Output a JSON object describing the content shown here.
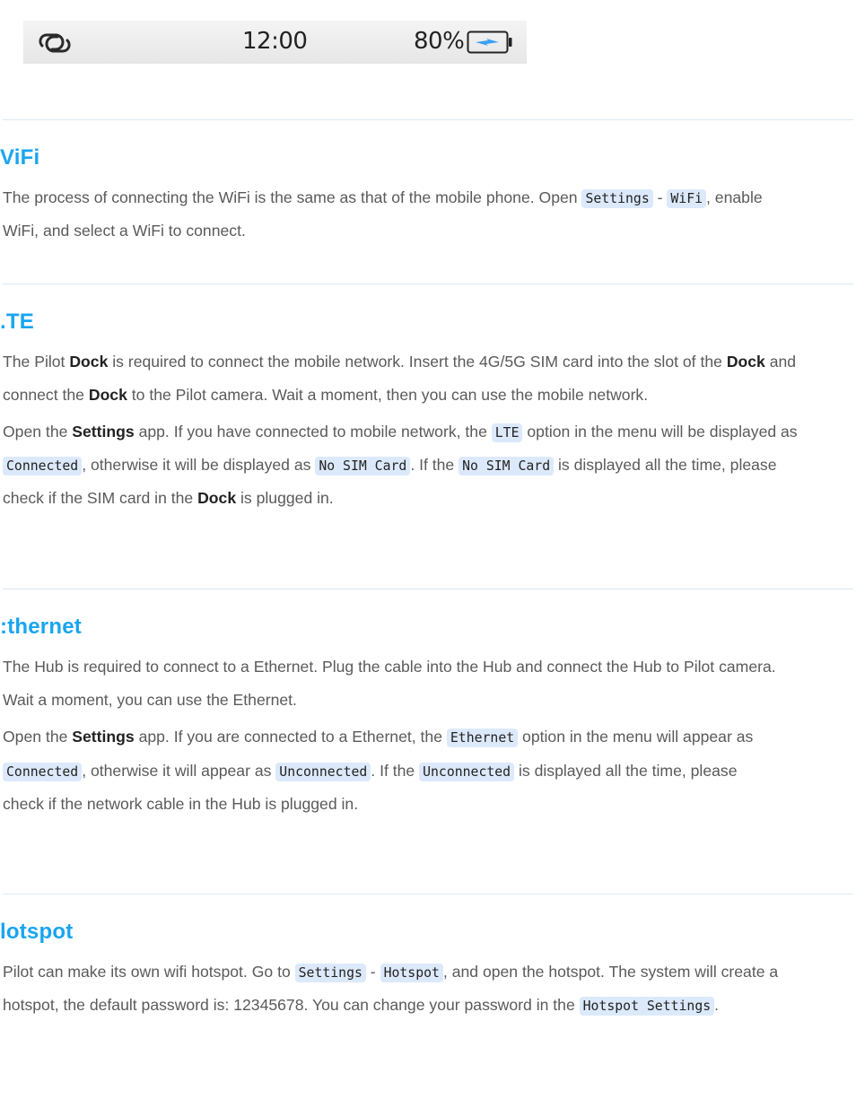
{
  "status_bar": {
    "left_icon": "link-icon",
    "time": "12:00",
    "battery_percent": "80%",
    "battery_icon": "battery-charging-icon",
    "accent_color": "#3aa0f5"
  },
  "colors": {
    "heading": "#18a5f0",
    "body_text": "#5a5a5a",
    "code_bg": "#dce9fb",
    "divider": "#dbe9f3"
  },
  "sections": [
    {
      "title": "WiFi",
      "title_visible": "ViFi",
      "lines": [
        [
          {
            "t": "text",
            "v": "The process of connecting the WiFi is the same as that of the mobile phone. Open "
          },
          {
            "t": "code",
            "v": "Settings"
          },
          {
            "t": "text",
            "v": " - "
          },
          {
            "t": "code",
            "v": "WiFi"
          },
          {
            "t": "text",
            "v": ", enable"
          }
        ],
        [
          {
            "t": "text",
            "v": "WiFi, and select a WiFi to connect."
          }
        ]
      ]
    },
    {
      "title": "LTE",
      "title_visible": ".TE",
      "lines": [
        [
          {
            "t": "text",
            "v": "The Pilot "
          },
          {
            "t": "bold",
            "v": "Dock"
          },
          {
            "t": "text",
            "v": " is required to connect the mobile network. Insert the 4G/5G SIM card into the slot of the "
          },
          {
            "t": "bold",
            "v": "Dock"
          },
          {
            "t": "text",
            "v": " and"
          }
        ],
        [
          {
            "t": "text",
            "v": "connect the "
          },
          {
            "t": "bold",
            "v": "Dock"
          },
          {
            "t": "text",
            "v": " to the Pilot camera. Wait a moment, then you can use the mobile network."
          }
        ],
        [
          {
            "t": "text",
            "v": "Open the "
          },
          {
            "t": "bold",
            "v": "Settings"
          },
          {
            "t": "text",
            "v": " app. If you have connected to mobile network, the "
          },
          {
            "t": "code",
            "v": "LTE"
          },
          {
            "t": "text",
            "v": " option in the menu will be displayed as"
          }
        ],
        [
          {
            "t": "code",
            "v": "Connected"
          },
          {
            "t": "text",
            "v": ", otherwise it will be displayed as "
          },
          {
            "t": "code",
            "v": "No SIM Card"
          },
          {
            "t": "text",
            "v": ". If the "
          },
          {
            "t": "code",
            "v": "No SIM Card"
          },
          {
            "t": "text",
            "v": " is displayed all the time, please"
          }
        ],
        [
          {
            "t": "text",
            "v": "check if the SIM card in the "
          },
          {
            "t": "bold",
            "v": "Dock"
          },
          {
            "t": "text",
            "v": " is plugged in."
          }
        ]
      ]
    },
    {
      "title": "Ethernet",
      "title_visible": ":thernet",
      "lines": [
        [
          {
            "t": "text",
            "v": "The Hub is required to connect to a Ethernet. Plug the cable into the Hub and connect the Hub to Pilot camera."
          }
        ],
        [
          {
            "t": "text",
            "v": "Wait a moment, you can use the Ethernet."
          }
        ],
        [
          {
            "t": "text",
            "v": "Open the "
          },
          {
            "t": "bold",
            "v": "Settings"
          },
          {
            "t": "text",
            "v": " app. If you are connected to a Ethernet, the "
          },
          {
            "t": "code",
            "v": "Ethernet"
          },
          {
            "t": "text",
            "v": " option in the menu will appear as"
          }
        ],
        [
          {
            "t": "code",
            "v": "Connected"
          },
          {
            "t": "text",
            "v": ", otherwise it will appear as "
          },
          {
            "t": "code",
            "v": "Unconnected"
          },
          {
            "t": "text",
            "v": ". If the "
          },
          {
            "t": "code",
            "v": "Unconnected"
          },
          {
            "t": "text",
            "v": " is displayed all the time, please"
          }
        ],
        [
          {
            "t": "text",
            "v": "check if the network cable in the Hub is plugged in."
          }
        ]
      ]
    },
    {
      "title": "Hotspot",
      "title_visible": "lotspot",
      "lines": [
        [
          {
            "t": "text",
            "v": "Pilot can make its own wifi hotspot. Go to "
          },
          {
            "t": "code",
            "v": "Settings"
          },
          {
            "t": "text",
            "v": " - "
          },
          {
            "t": "code",
            "v": "Hotspot"
          },
          {
            "t": "text",
            "v": ", and open the hotspot. The system will create a"
          }
        ],
        [
          {
            "t": "text",
            "v": "hotspot, the default password is: 12345678. You can change your password in the "
          },
          {
            "t": "code",
            "v": "Hotspot Settings"
          },
          {
            "t": "text",
            "v": "."
          }
        ]
      ]
    }
  ]
}
